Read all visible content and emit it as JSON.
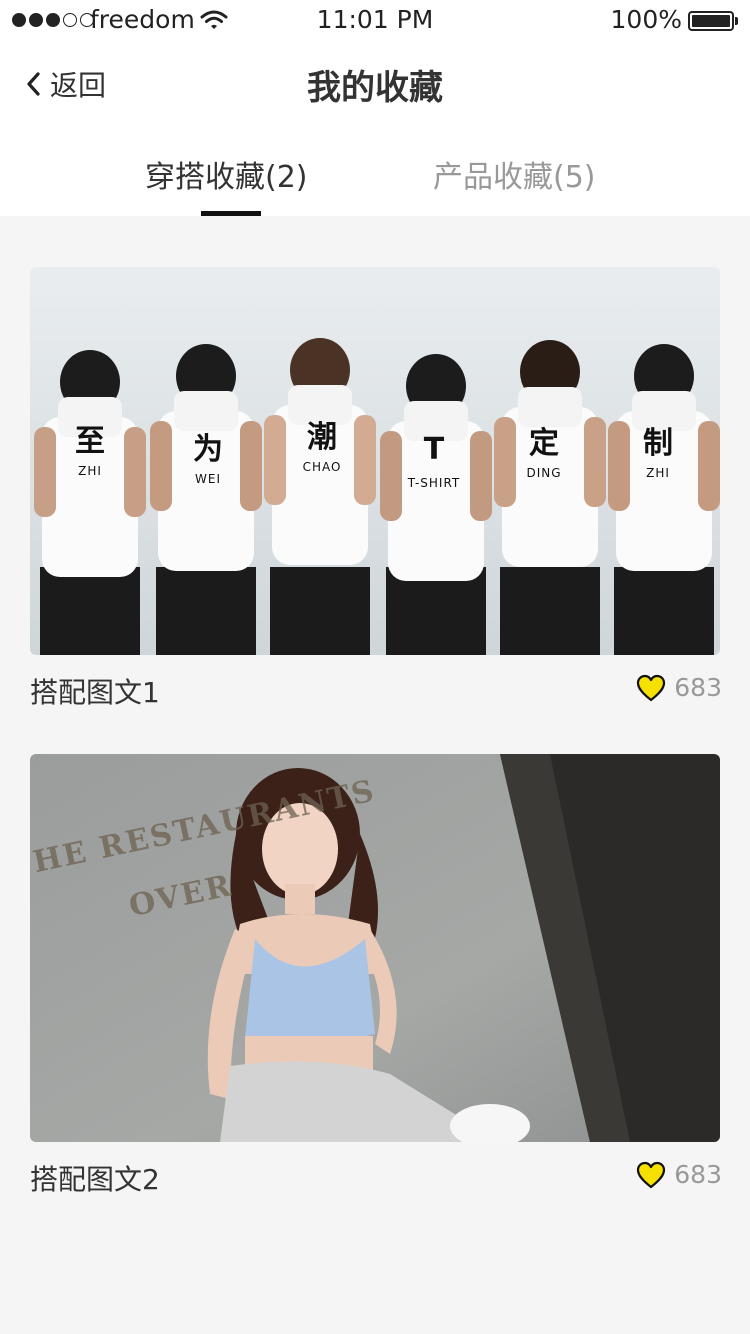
{
  "status_bar": {
    "carrier": "freedom",
    "time": "11:01 PM",
    "battery": "100%",
    "signal_bars_filled": 3,
    "signal_bars_total": 5
  },
  "nav": {
    "back_label": "返回",
    "title": "我的收藏"
  },
  "tabs": [
    {
      "label": "穿搭收藏(2)",
      "active": true
    },
    {
      "label": "产品收藏(5)",
      "active": false
    }
  ],
  "items": [
    {
      "title": "搭配图文1",
      "likes": "683",
      "photo_text": {
        "chars": [
          "至",
          "为",
          "潮",
          "T",
          "定",
          "制"
        ],
        "subs": [
          "ZHI",
          "WEI",
          "CHAO",
          "T-SHIRT",
          "DING",
          "ZHI"
        ]
      }
    },
    {
      "title": "搭配图文2",
      "likes": "683",
      "photo_text": {
        "line1": "HE RESTAURANTS",
        "line2": "OVER"
      }
    }
  ],
  "colors": {
    "heart": "#f5e000",
    "accent": "#111111",
    "background": "#f5f5f5"
  },
  "icons": {
    "back": "chevron-left-icon",
    "like": "heart-icon",
    "wifi": "wifi-icon",
    "battery": "battery-icon"
  }
}
